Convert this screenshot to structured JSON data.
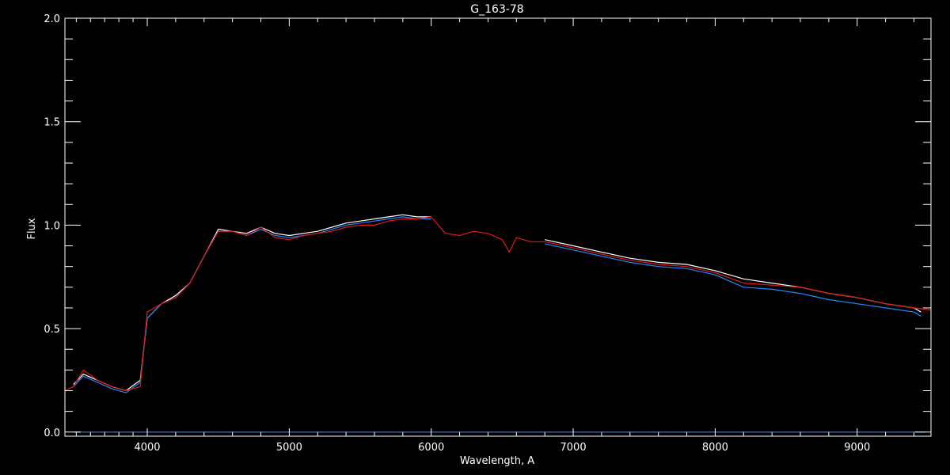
{
  "chart_data": {
    "type": "line",
    "title": "G_163-78",
    "xlabel": "Wavelength, A",
    "ylabel": "Flux",
    "xlim": [
      3420,
      9520
    ],
    "ylim": [
      -0.02,
      2.0
    ],
    "xticks": [
      4000,
      5000,
      6000,
      7000,
      8000,
      9000
    ],
    "xtick_labels": [
      "4000",
      "5000",
      "6000",
      "7000",
      "8000",
      "9000"
    ],
    "yticks": [
      0.0,
      0.5,
      1.0,
      1.5,
      2.0
    ],
    "ytick_labels": [
      "0.0",
      "0.5",
      "1.0",
      "1.5",
      "2.0"
    ],
    "colors": {
      "background": "#000000",
      "axes": "#ffffff",
      "observed_white": "#ffffff",
      "observed_blue": "#1e88ff",
      "model_red": "#e01818"
    },
    "series": [
      {
        "color": "#ffffff",
        "x": [
          3480,
          3550,
          3650,
          3750,
          3850,
          3950,
          4000,
          4100,
          4200,
          4300,
          4400,
          4500,
          4600,
          4700,
          4800,
          4900,
          5000,
          5100,
          5200,
          5300,
          5400,
          5500,
          5600,
          5700,
          5800,
          5900,
          6000
        ],
        "y": [
          0.23,
          0.28,
          0.25,
          0.22,
          0.2,
          0.25,
          0.55,
          0.62,
          0.66,
          0.72,
          0.85,
          0.98,
          0.97,
          0.96,
          0.99,
          0.96,
          0.95,
          0.96,
          0.97,
          0.99,
          1.01,
          1.02,
          1.03,
          1.04,
          1.05,
          1.04,
          1.04
        ]
      },
      {
        "color": "#ffffff",
        "x": [
          6800,
          7000,
          7200,
          7400,
          7600,
          7800,
          8000,
          8200,
          8400,
          8600,
          8800,
          9000,
          9200,
          9400,
          9450
        ],
        "y": [
          0.93,
          0.9,
          0.87,
          0.84,
          0.82,
          0.81,
          0.78,
          0.74,
          0.72,
          0.7,
          0.67,
          0.65,
          0.62,
          0.6,
          0.58
        ]
      },
      {
        "color": "#1e88ff",
        "x": [
          3480,
          3550,
          3650,
          3750,
          3850,
          3950,
          4000,
          4100,
          4200,
          4300,
          4400,
          4500,
          4600,
          4700,
          4800,
          4900,
          5000,
          5100,
          5200,
          5300,
          5400,
          5500,
          5600,
          5700,
          5800,
          5900,
          6000
        ],
        "y": [
          0.22,
          0.27,
          0.24,
          0.21,
          0.19,
          0.24,
          0.55,
          0.62,
          0.65,
          0.72,
          0.85,
          0.97,
          0.97,
          0.95,
          0.98,
          0.95,
          0.94,
          0.95,
          0.96,
          0.98,
          1.0,
          1.01,
          1.02,
          1.03,
          1.04,
          1.03,
          1.03
        ]
      },
      {
        "color": "#1e88ff",
        "x": [
          6800,
          7000,
          7200,
          7400,
          7600,
          7800,
          8000,
          8200,
          8400,
          8600,
          8800,
          9000,
          9200,
          9400,
          9450
        ],
        "y": [
          0.91,
          0.88,
          0.85,
          0.82,
          0.8,
          0.79,
          0.76,
          0.7,
          0.69,
          0.67,
          0.64,
          0.62,
          0.6,
          0.58,
          0.56
        ]
      },
      {
        "color": "#1e88ff",
        "x": [
          3480,
          9480
        ],
        "y": [
          0.0,
          0.0
        ]
      },
      {
        "color": "#e01818",
        "x": [
          3420,
          3480,
          3550,
          3650,
          3750,
          3850,
          3950,
          4000,
          4100,
          4200,
          4300,
          4400,
          4500,
          4600,
          4700,
          4800,
          4900,
          5000,
          5100,
          5200,
          5300,
          5400,
          5500,
          5600,
          5700,
          5800,
          5900,
          6000,
          6100,
          6200,
          6300,
          6400,
          6500,
          6550,
          6600,
          6700,
          6800,
          7000,
          7200,
          7400,
          7600,
          7800,
          8000,
          8200,
          8400,
          8600,
          8800,
          9000,
          9200,
          9400,
          9520
        ],
        "y": [
          0.2,
          0.22,
          0.3,
          0.25,
          0.22,
          0.2,
          0.22,
          0.58,
          0.62,
          0.65,
          0.72,
          0.85,
          0.97,
          0.97,
          0.95,
          0.99,
          0.94,
          0.93,
          0.95,
          0.96,
          0.97,
          0.99,
          1.0,
          1.0,
          1.02,
          1.03,
          1.03,
          1.04,
          0.96,
          0.95,
          0.97,
          0.96,
          0.93,
          0.87,
          0.94,
          0.92,
          0.92,
          0.89,
          0.86,
          0.83,
          0.81,
          0.8,
          0.77,
          0.72,
          0.71,
          0.7,
          0.67,
          0.65,
          0.62,
          0.6,
          0.59
        ]
      }
    ]
  }
}
